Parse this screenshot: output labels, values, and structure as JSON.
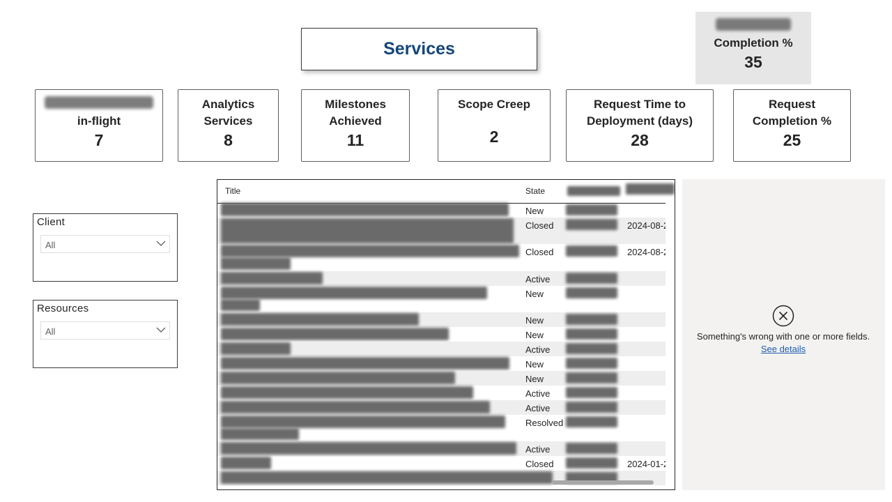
{
  "header": {
    "title": "Services"
  },
  "completion_card": {
    "label": "Completion %",
    "value": "35"
  },
  "kpis": {
    "in_flight": {
      "label": "in-flight",
      "value": "7"
    },
    "analytics": {
      "label1": "Analytics",
      "label2": "Services",
      "value": "8"
    },
    "milestones": {
      "label1": "Milestones",
      "label2": "Achieved",
      "value": "11"
    },
    "scope": {
      "label": "Scope Creep",
      "value": "2"
    },
    "request_time": {
      "label1": "Request Time to",
      "label2": "Deployment (days)",
      "value": "28"
    },
    "request_completion": {
      "label1": "Request",
      "label2": "Completion %",
      "value": "25"
    }
  },
  "slicers": {
    "client": {
      "title": "Client",
      "value": "All"
    },
    "resources": {
      "title": "Resources",
      "value": "All"
    }
  },
  "table": {
    "headers": {
      "title": "Title",
      "state": "State"
    },
    "rows": [
      {
        "state": "New",
        "date2": ""
      },
      {
        "state": "Closed",
        "date2": "2024-08-2"
      },
      {
        "state": "Closed",
        "date2": "2024-08-2"
      },
      {
        "state": "Active",
        "date2": ""
      },
      {
        "state": "New",
        "date2": ""
      },
      {
        "state": "New",
        "date2": ""
      },
      {
        "state": "New",
        "date2": ""
      },
      {
        "state": "Active",
        "date2": ""
      },
      {
        "state": "New",
        "date2": ""
      },
      {
        "state": "New",
        "date2": ""
      },
      {
        "state": "Active",
        "date2": ""
      },
      {
        "state": "Active",
        "date2": ""
      },
      {
        "state": "Resolved",
        "date2": ""
      },
      {
        "state": "Active",
        "date2": ""
      },
      {
        "state": "Closed",
        "date2": "2024-01-2"
      }
    ]
  },
  "error_panel": {
    "icon": "error-circle-x-icon",
    "message": "Something's wrong with one or more fields.",
    "link": "See details"
  }
}
